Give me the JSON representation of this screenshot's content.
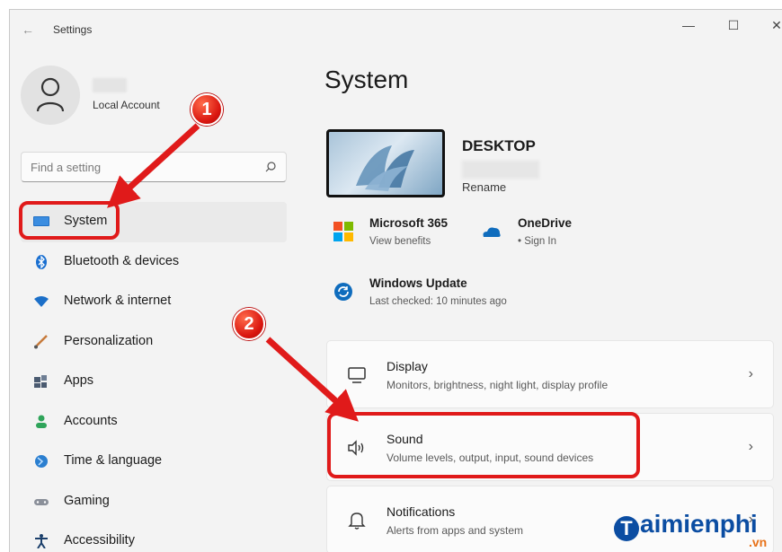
{
  "titlebar": {
    "back_icon": "back-arrow-icon",
    "title": "Settings",
    "minimize": "—",
    "maximize": "☐",
    "close": "✕"
  },
  "user": {
    "account_type": "Local Account"
  },
  "search": {
    "placeholder": "Find a setting"
  },
  "sidebar": {
    "items": [
      {
        "label": "System",
        "icon": "system-icon",
        "active": true
      },
      {
        "label": "Bluetooth & devices",
        "icon": "bluetooth-icon"
      },
      {
        "label": "Network & internet",
        "icon": "wifi-icon"
      },
      {
        "label": "Personalization",
        "icon": "brush-icon"
      },
      {
        "label": "Apps",
        "icon": "apps-icon"
      },
      {
        "label": "Accounts",
        "icon": "accounts-icon"
      },
      {
        "label": "Time & language",
        "icon": "time-language-icon"
      },
      {
        "label": "Gaming",
        "icon": "gaming-icon"
      },
      {
        "label": "Accessibility",
        "icon": "accessibility-icon"
      }
    ]
  },
  "main": {
    "title": "System",
    "device": {
      "name": "DESKTOP",
      "rename": "Rename"
    },
    "quick_links": [
      {
        "title": "Microsoft 365",
        "subtitle": "View benefits",
        "icon": "microsoft-365-icon"
      },
      {
        "title": "OneDrive",
        "subtitle": "• Sign In",
        "icon": "onedrive-icon"
      },
      {
        "title": "Windows Update",
        "subtitle": "Last checked: 10 minutes ago",
        "icon": "windows-update-icon"
      }
    ],
    "cards": [
      {
        "title": "Display",
        "desc": "Monitors, brightness, night light, display profile",
        "icon": "display-icon"
      },
      {
        "title": "Sound",
        "desc": "Volume levels, output, input, sound devices",
        "icon": "speaker-icon"
      },
      {
        "title": "Notifications",
        "desc": "Alerts from apps and system",
        "icon": "bell-icon"
      }
    ],
    "chevron": "›"
  },
  "annotations": {
    "badge_1": "1",
    "badge_2": "2",
    "color": "#e01a1a"
  },
  "watermark": {
    "brand_initial": "T",
    "brand_rest": "aimienphi",
    "suffix": ".vn"
  }
}
